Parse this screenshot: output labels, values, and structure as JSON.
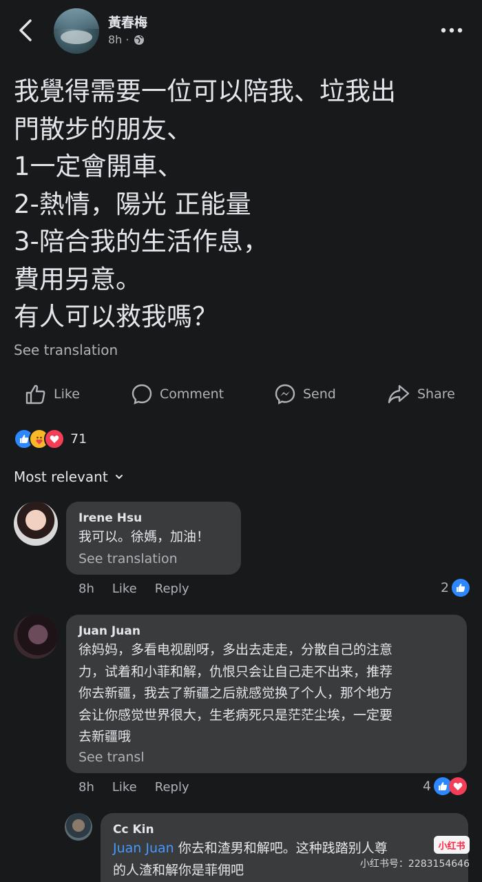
{
  "post": {
    "author": "黃春梅",
    "time": "8h ·",
    "lines": [
      "我覺得需要一位可以陪我、垃我出",
      "門散步的朋友、",
      "1一定會開車、",
      "2-熱情，陽光 正能量",
      "3-陪合我的生活作息，",
      "費用另意。",
      "有人可以救我嗎？"
    ],
    "see_translation": "See translation"
  },
  "actions": {
    "like": "Like",
    "comment": "Comment",
    "send": "Send",
    "share": "Share"
  },
  "reactions": {
    "count": "71"
  },
  "sort": {
    "label": "Most relevant"
  },
  "comments": [
    {
      "name": "Irene Hsu",
      "text_lines": [
        "我可以。徐媽，加油！"
      ],
      "see_translation": "See translation",
      "time": "8h",
      "like": "Like",
      "reply": "Reply",
      "reaction_count": "2"
    },
    {
      "name": "Juan Juan",
      "text_lines": [
        "徐妈妈，多看电视剧呀，多出去走走，分散自己的注意",
        "力，试着和小菲和解，仇恨只会让自己走不出来，推荐",
        "你去新疆，我去了新疆之后就感觉换了个人，那个地方",
        "会让你感觉世界很大，生老病死只是茫茫尘埃，一定要",
        "去新疆哦"
      ],
      "see_translation": "See transl",
      "time": "8h",
      "like": "Like",
      "reply": "Reply",
      "reaction_count": "4"
    },
    {
      "name": "Cc Kin",
      "mention": "Juan Juan",
      "text_line1_rest": " 你去和渣男和解吧。这种践踏别人尊",
      "text_line2": "的人渣和解你是菲佣吧"
    }
  ],
  "watermark": {
    "logo": "小红书",
    "id": "小红书号：2283154646"
  },
  "colors": {
    "background": "#18191a",
    "bubble": "#3a3b3c",
    "text": "#e4e6eb",
    "muted": "#b0b3b8",
    "like_blue": "#2d88ff",
    "love_red": "#f33e58",
    "mention_blue": "#4599ff"
  },
  "icons": [
    "back-arrow-icon",
    "globe-icon",
    "more-dots-icon",
    "like-thumb-icon",
    "comment-bubble-icon",
    "messenger-send-icon",
    "share-arrow-icon",
    "chevron-down-icon"
  ]
}
